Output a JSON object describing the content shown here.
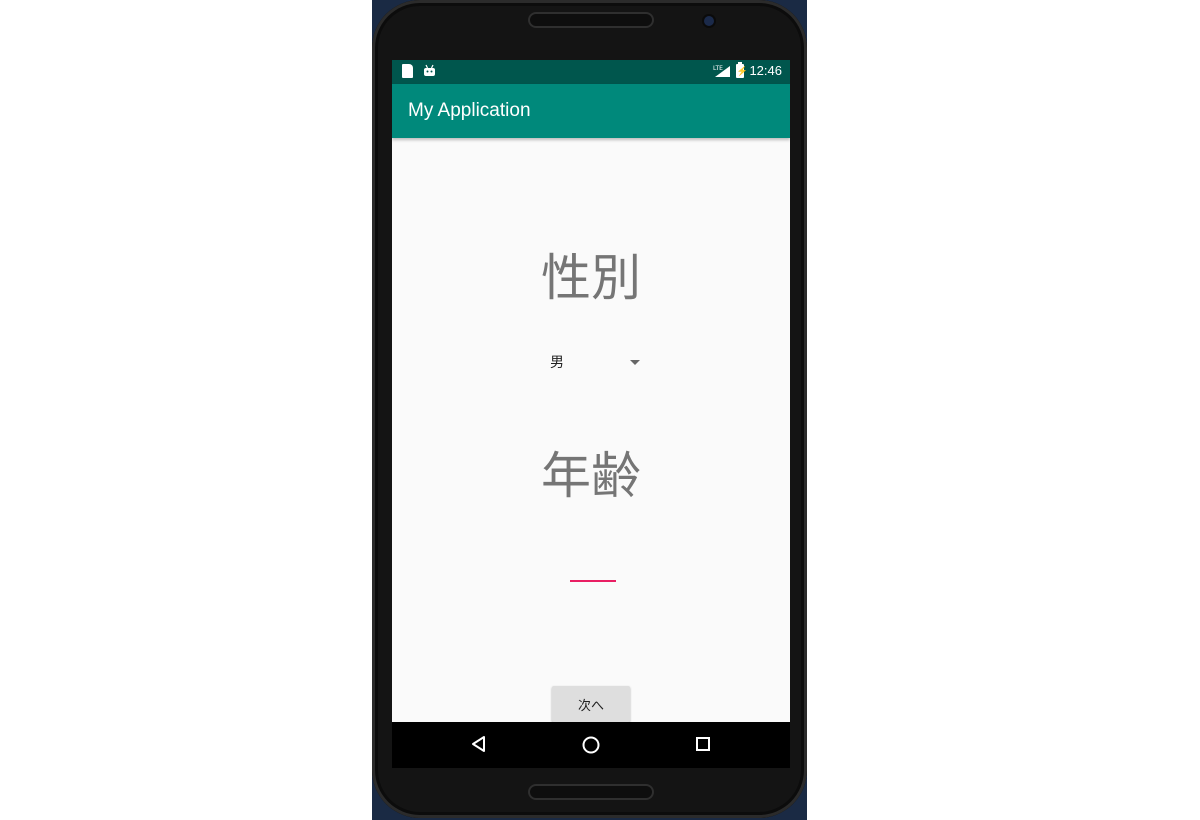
{
  "status_bar": {
    "time": "12:46",
    "network_label": "LTE",
    "icons": [
      "sd-card-icon",
      "android-icon",
      "lte-signal-icon",
      "battery-charging-icon"
    ]
  },
  "app_bar": {
    "title": "My Application"
  },
  "form": {
    "gender_label": "性別",
    "gender_selected": "男",
    "age_label": "年齢",
    "age_value": "",
    "next_button": "次へ"
  },
  "nav_bar": {
    "icons": [
      "back-icon",
      "home-icon",
      "recents-icon"
    ]
  },
  "colors": {
    "status_bar": "#00564d",
    "app_bar": "#00897b",
    "accent": "#e91e63",
    "background": "#fafafa",
    "label_text": "#757575"
  }
}
